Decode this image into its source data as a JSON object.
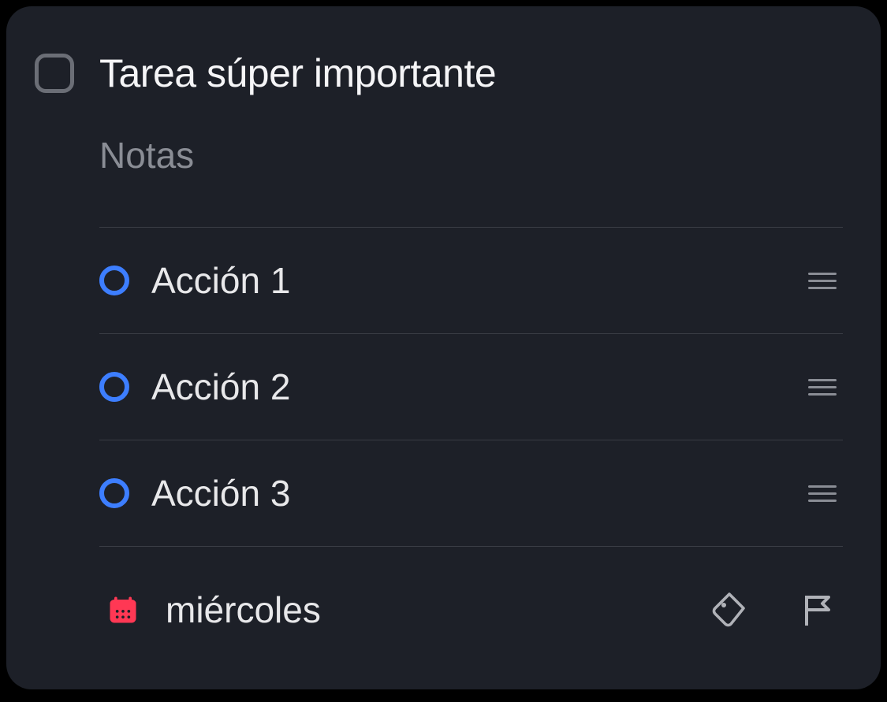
{
  "task": {
    "title": "Tarea súper importante",
    "notes_placeholder": "Notas"
  },
  "subtasks": [
    {
      "label": "Acción 1"
    },
    {
      "label": "Acción 2"
    },
    {
      "label": "Acción 3"
    }
  ],
  "schedule": {
    "due_date": "miércoles"
  },
  "colors": {
    "accent_blue": "#3d7eff",
    "calendar_red": "#ff3854"
  }
}
